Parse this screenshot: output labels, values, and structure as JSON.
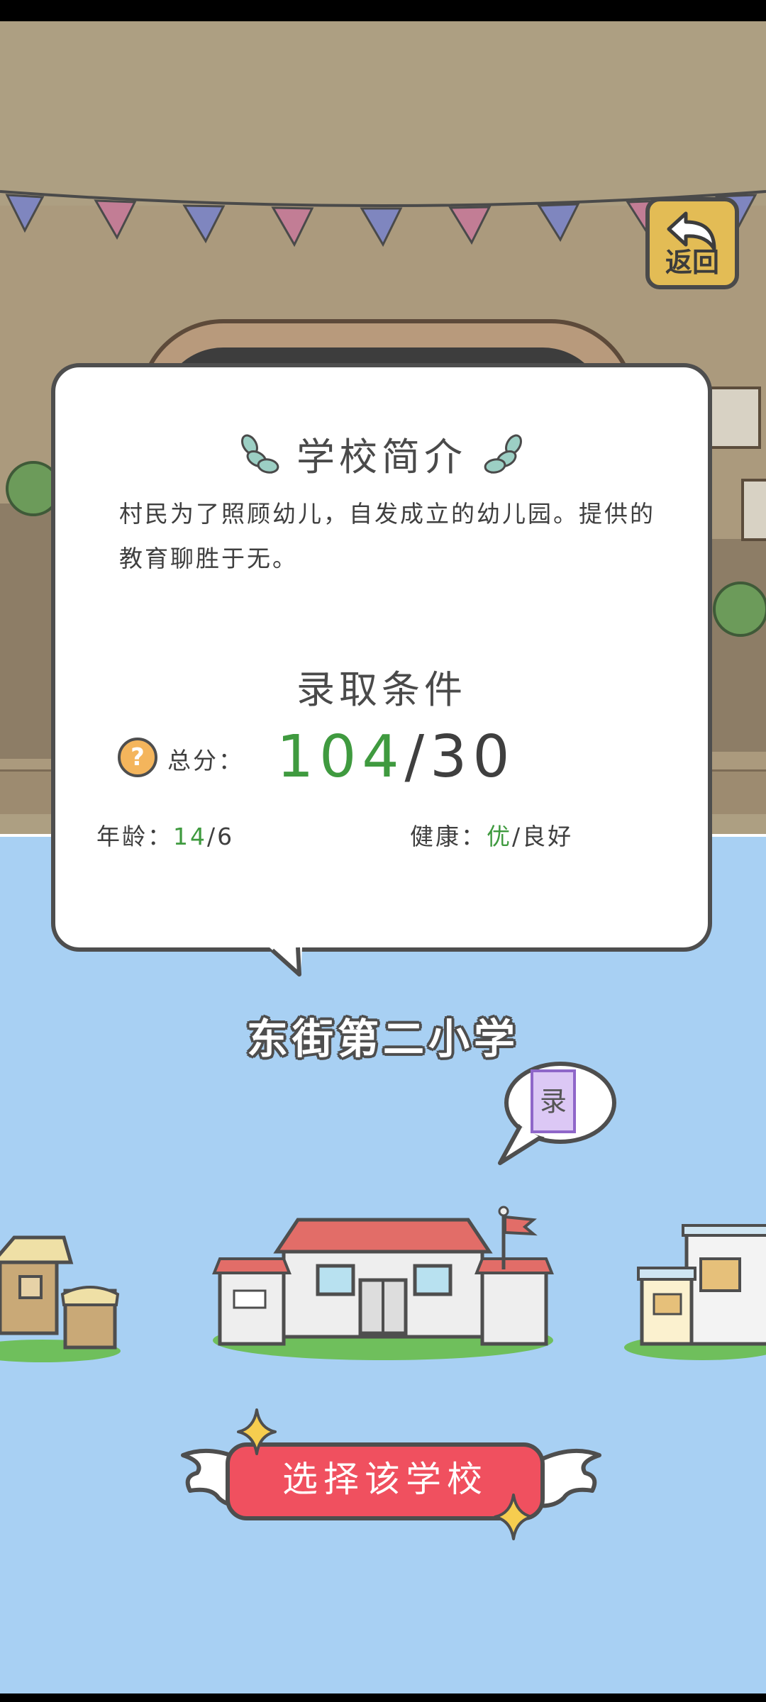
{
  "back_button": {
    "label": "返回",
    "icon": "back-arrow-icon"
  },
  "intro_card": {
    "title": "学校简介",
    "description": "村民为了照顾幼儿，自发成立的幼儿园。提供的教育聊胜于无。",
    "conditions_title": "录取条件",
    "total_label": "总分：",
    "total_current": "104",
    "total_separator": "/",
    "total_required": "30",
    "age_label": "年龄：",
    "age_current": "14",
    "age_required": "/6",
    "health_label": "健康：",
    "health_current": "优",
    "health_required": "/良好"
  },
  "school": {
    "name": "东街第二小学",
    "status_badge": "录"
  },
  "select_button": {
    "label": "选择该学校"
  },
  "colors": {
    "accent_green": "#3f9a3f",
    "button_red": "#f0505f",
    "sky_blue": "#a8d0f3",
    "back_yellow": "#e3bc55"
  }
}
